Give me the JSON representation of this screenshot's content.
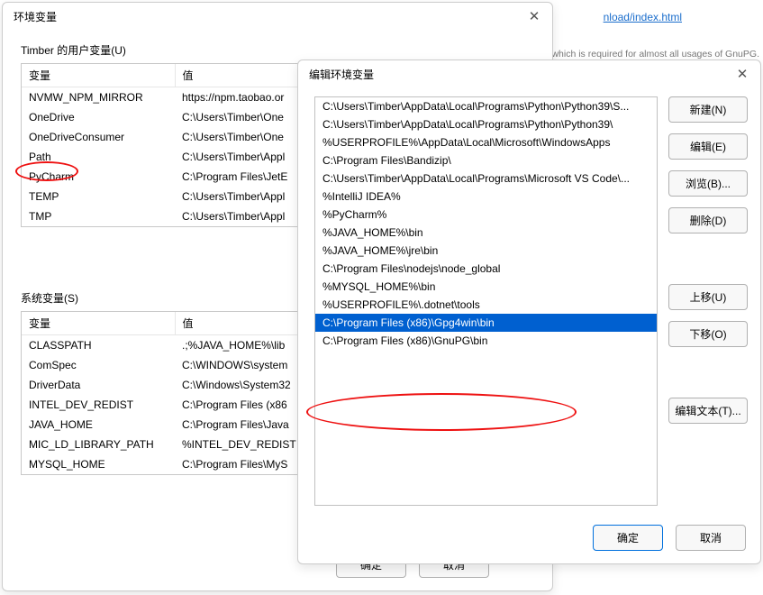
{
  "bg": {
    "link": "nload/index.html",
    "text": "itry dialogs which is required for almost all usages of GnuPG."
  },
  "envDialog": {
    "title": "环境变量",
    "userLabel": "Timber 的用户变量(U)",
    "sysLabel": "系统变量(S)",
    "colVar": "变量",
    "colVal": "值",
    "userVars": [
      {
        "name": "NVMW_NPM_MIRROR",
        "value": "https://npm.taobao.or"
      },
      {
        "name": "OneDrive",
        "value": "C:\\Users\\Timber\\One"
      },
      {
        "name": "OneDriveConsumer",
        "value": "C:\\Users\\Timber\\One"
      },
      {
        "name": "Path",
        "value": "C:\\Users\\Timber\\Appl"
      },
      {
        "name": "PyCharm",
        "value": "C:\\Program Files\\JetE"
      },
      {
        "name": "TEMP",
        "value": "C:\\Users\\Timber\\Appl"
      },
      {
        "name": "TMP",
        "value": "C:\\Users\\Timber\\Appl"
      }
    ],
    "sysVars": [
      {
        "name": "CLASSPATH",
        "value": ".;%JAVA_HOME%\\lib"
      },
      {
        "name": "ComSpec",
        "value": "C:\\WINDOWS\\system"
      },
      {
        "name": "DriverData",
        "value": "C:\\Windows\\System32"
      },
      {
        "name": "INTEL_DEV_REDIST",
        "value": "C:\\Program Files (x86"
      },
      {
        "name": "JAVA_HOME",
        "value": "C:\\Program Files\\Java"
      },
      {
        "name": "MIC_LD_LIBRARY_PATH",
        "value": "%INTEL_DEV_REDIST"
      },
      {
        "name": "MYSQL_HOME",
        "value": "C:\\Program Files\\MyS"
      }
    ],
    "ok": "确定",
    "cancel": "取消"
  },
  "editDialog": {
    "title": "编辑环境变量",
    "paths": [
      "C:\\Users\\Timber\\AppData\\Local\\Programs\\Python\\Python39\\S...",
      "C:\\Users\\Timber\\AppData\\Local\\Programs\\Python\\Python39\\",
      "%USERPROFILE%\\AppData\\Local\\Microsoft\\WindowsApps",
      "C:\\Program Files\\Bandizip\\",
      "C:\\Users\\Timber\\AppData\\Local\\Programs\\Microsoft VS Code\\...",
      "%IntelliJ IDEA%",
      "%PyCharm%",
      "%JAVA_HOME%\\bin",
      "%JAVA_HOME%\\jre\\bin",
      "C:\\Program Files\\nodejs\\node_global",
      "%MYSQL_HOME%\\bin",
      "%USERPROFILE%\\.dotnet\\tools",
      "C:\\Program Files (x86)\\Gpg4win\\bin",
      "C:\\Program Files (x86)\\GnuPG\\bin"
    ],
    "selectedIndex": 12,
    "buttons": {
      "new": "新建(N)",
      "edit": "编辑(E)",
      "browse": "浏览(B)...",
      "delete": "删除(D)",
      "moveUp": "上移(U)",
      "moveDown": "下移(O)",
      "editText": "编辑文本(T)..."
    },
    "ok": "确定",
    "cancel": "取消"
  }
}
